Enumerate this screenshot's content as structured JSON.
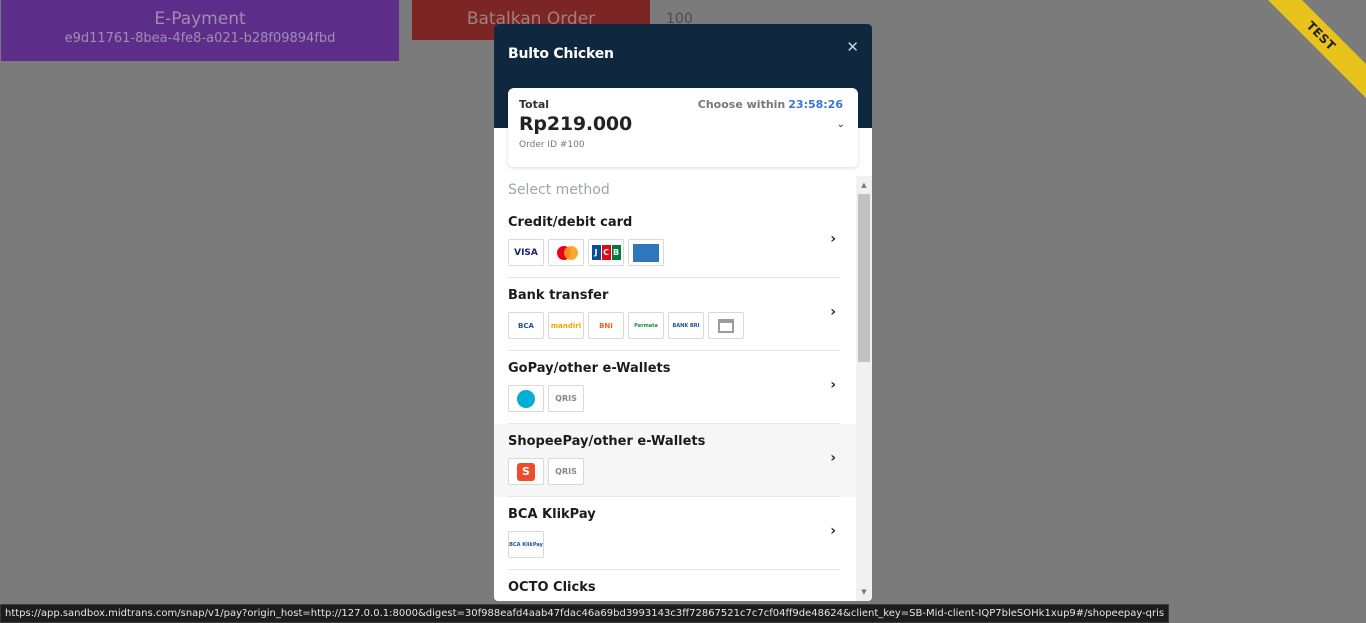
{
  "background": {
    "payment_title": "E-Payment",
    "payment_id": "e9d11761-8bea-4fe8-a021-b28f09894fbd",
    "cancel_button": "Batalkan Order",
    "order_number": "100"
  },
  "ribbon": {
    "label": "TEST",
    "color": "#e7c31b"
  },
  "modal": {
    "merchant": "Bulto Chicken",
    "close_icon": "close-icon",
    "summary": {
      "total_label": "Total",
      "amount": "Rp219.000",
      "order_id": "Order ID #100",
      "choose_label": "Choose within",
      "timer": "23:58:26"
    },
    "select_title": "Select method",
    "methods": [
      {
        "name": "Credit/debit card",
        "logos": [
          "VISA",
          "mastercard",
          "JCB",
          "AMEX"
        ]
      },
      {
        "name": "Bank transfer",
        "logos": [
          "BCA",
          "mandiri",
          "BNI",
          "Permata",
          "BANK BRI",
          "bank-icon"
        ]
      },
      {
        "name": "GoPay/other e-Wallets",
        "logos": [
          "gopay",
          "QRIS"
        ]
      },
      {
        "name": "ShopeePay/other e-Wallets",
        "logos": [
          "S",
          "QRIS"
        ]
      },
      {
        "name": "BCA KlikPay",
        "logos": [
          "BCA KlikPay"
        ]
      },
      {
        "name": "OCTO Clicks",
        "logos": []
      }
    ],
    "colors": {
      "header": "#10283f",
      "timer": "#3b76d6"
    }
  },
  "status_url": "https://app.sandbox.midtrans.com/snap/v1/pay?origin_host=http://127.0.0.1:8000&digest=30f988eafd4aab47fdac46a69bd3993143c3ff72867521c7c7cf04ff9de48624&client_key=SB-Mid-client-IQP7bleSOHk1xup9#/shopeepay-qris"
}
